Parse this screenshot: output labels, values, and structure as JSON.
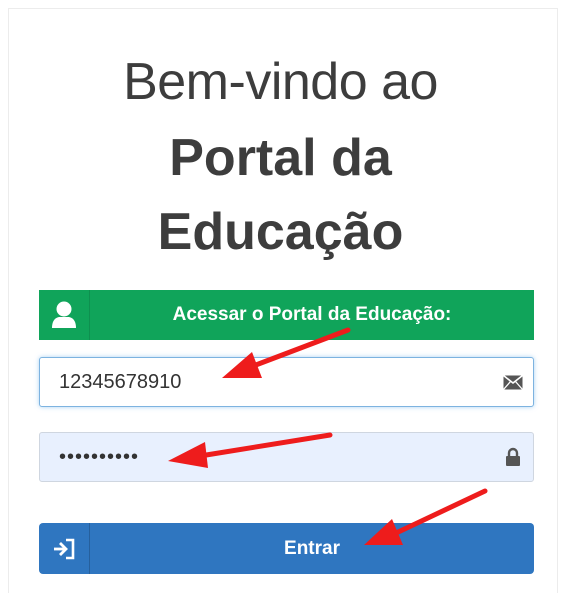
{
  "welcome": {
    "line1": "Bem-vindo ao",
    "line2": "Portal da",
    "line3": "Educação"
  },
  "banner": {
    "text": "Acessar o Portal da Educação:",
    "icon": "user-icon",
    "color": "#10a45a"
  },
  "login": {
    "username_value": "12345678910",
    "username_icon": "envelope-icon",
    "password_value": "••••••••••",
    "password_icon": "lock-icon"
  },
  "submit": {
    "label": "Entrar",
    "icon": "sign-in-icon",
    "color": "#2f76c0"
  },
  "annotations": {
    "arrow_color": "#ee1c1c"
  }
}
